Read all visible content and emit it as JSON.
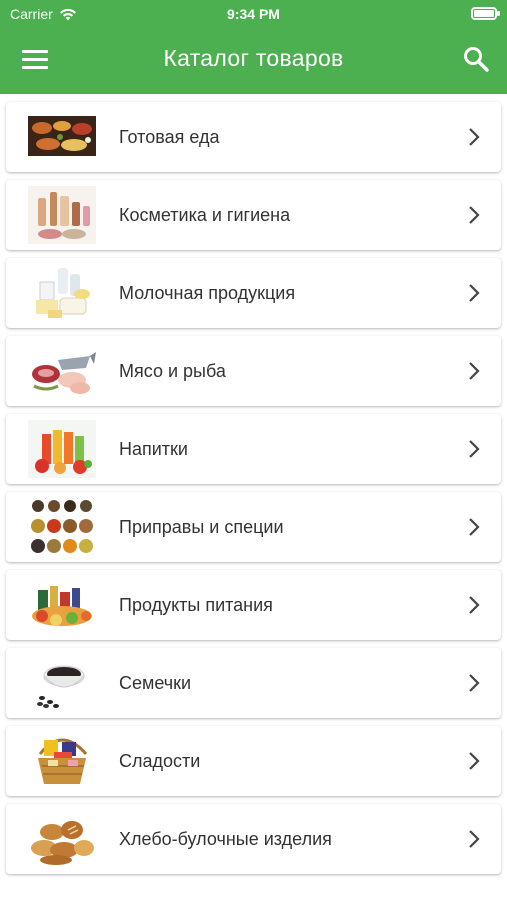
{
  "status_bar": {
    "carrier": "Carrier",
    "time": "9:34 PM"
  },
  "header": {
    "title": "Каталог товаров",
    "menu_icon": "hamburger-menu-icon",
    "search_icon": "search-icon"
  },
  "colors": {
    "primary": "#4caf50",
    "text": "#333333",
    "card": "#ffffff"
  },
  "categories": [
    {
      "label": "Готовая еда",
      "image": "prepared-food-image"
    },
    {
      "label": "Косметика и гигиена",
      "image": "cosmetics-image"
    },
    {
      "label": "Молочная продукция",
      "image": "dairy-image"
    },
    {
      "label": "Мясо и рыба",
      "image": "meat-fish-image"
    },
    {
      "label": "Напитки",
      "image": "drinks-image"
    },
    {
      "label": "Приправы и специи",
      "image": "spices-image"
    },
    {
      "label": "Продукты питания",
      "image": "groceries-image"
    },
    {
      "label": "Семечки",
      "image": "seeds-image"
    },
    {
      "label": "Сладости",
      "image": "sweets-image"
    },
    {
      "label": "Хлебо-булочные изделия",
      "image": "bakery-image"
    }
  ]
}
